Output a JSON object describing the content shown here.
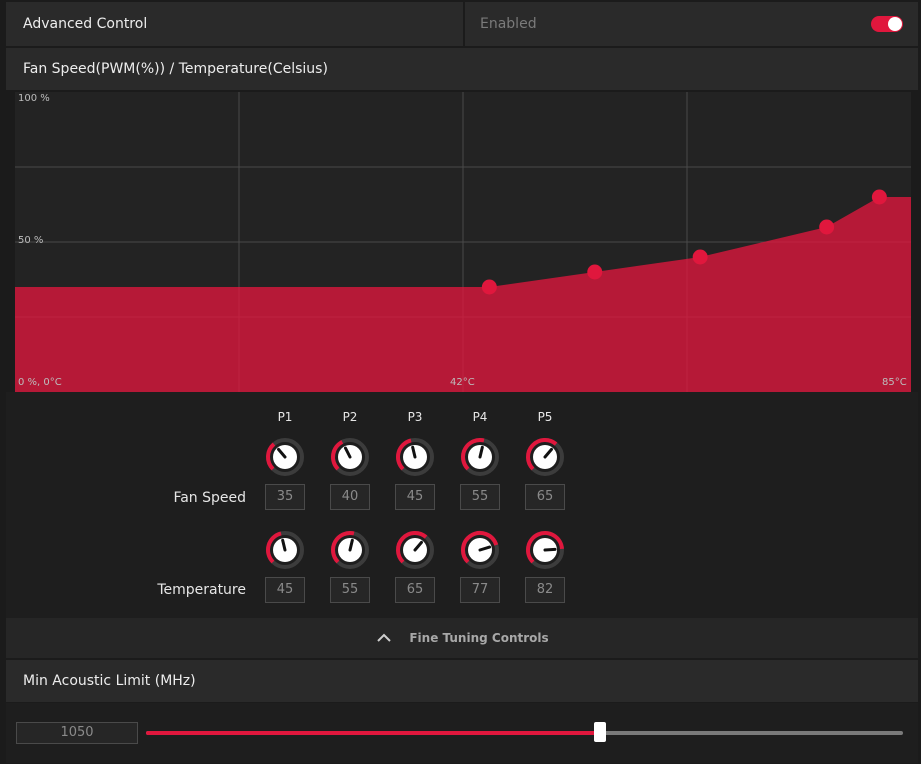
{
  "advanced": {
    "label": "Advanced Control",
    "status": "Enabled",
    "enabled": true
  },
  "fan_section": {
    "title": "Fan Speed(PWM(%)) / Temperature(Celsius)"
  },
  "chart": {
    "y_top_label": "100 %",
    "y_mid_label": "50 %",
    "origin_label": "0 %, 0°C",
    "x_mid_label": "42°C",
    "x_max_label": "85°C",
    "accent": "#e0173d"
  },
  "chart_data": {
    "type": "area",
    "title": "Fan Speed(PWM(%)) / Temperature(Celsius)",
    "xlabel": "",
    "ylabel": "",
    "xlim": [
      0,
      85
    ],
    "ylim": [
      0,
      100
    ],
    "grid": true,
    "points": [
      {
        "x": 45,
        "y": 35
      },
      {
        "x": 55,
        "y": 40
      },
      {
        "x": 65,
        "y": 45
      },
      {
        "x": 77,
        "y": 55
      },
      {
        "x": 82,
        "y": 65
      }
    ]
  },
  "points": [
    {
      "label": "P1",
      "fan": "35",
      "temp": "45"
    },
    {
      "label": "P2",
      "fan": "40",
      "temp": "55"
    },
    {
      "label": "P3",
      "fan": "45",
      "temp": "65"
    },
    {
      "label": "P4",
      "fan": "55",
      "temp": "77"
    },
    {
      "label": "P5",
      "fan": "65",
      "temp": "82"
    }
  ],
  "rows": {
    "fan_label": "Fan Speed",
    "temp_label": "Temperature"
  },
  "fine_tuning": {
    "label": "Fine Tuning Controls",
    "icon": "chevron-up-icon"
  },
  "acoustic": {
    "title": "Min Acoustic Limit (MHz)",
    "value": "1050",
    "slider_fraction": 0.6
  }
}
